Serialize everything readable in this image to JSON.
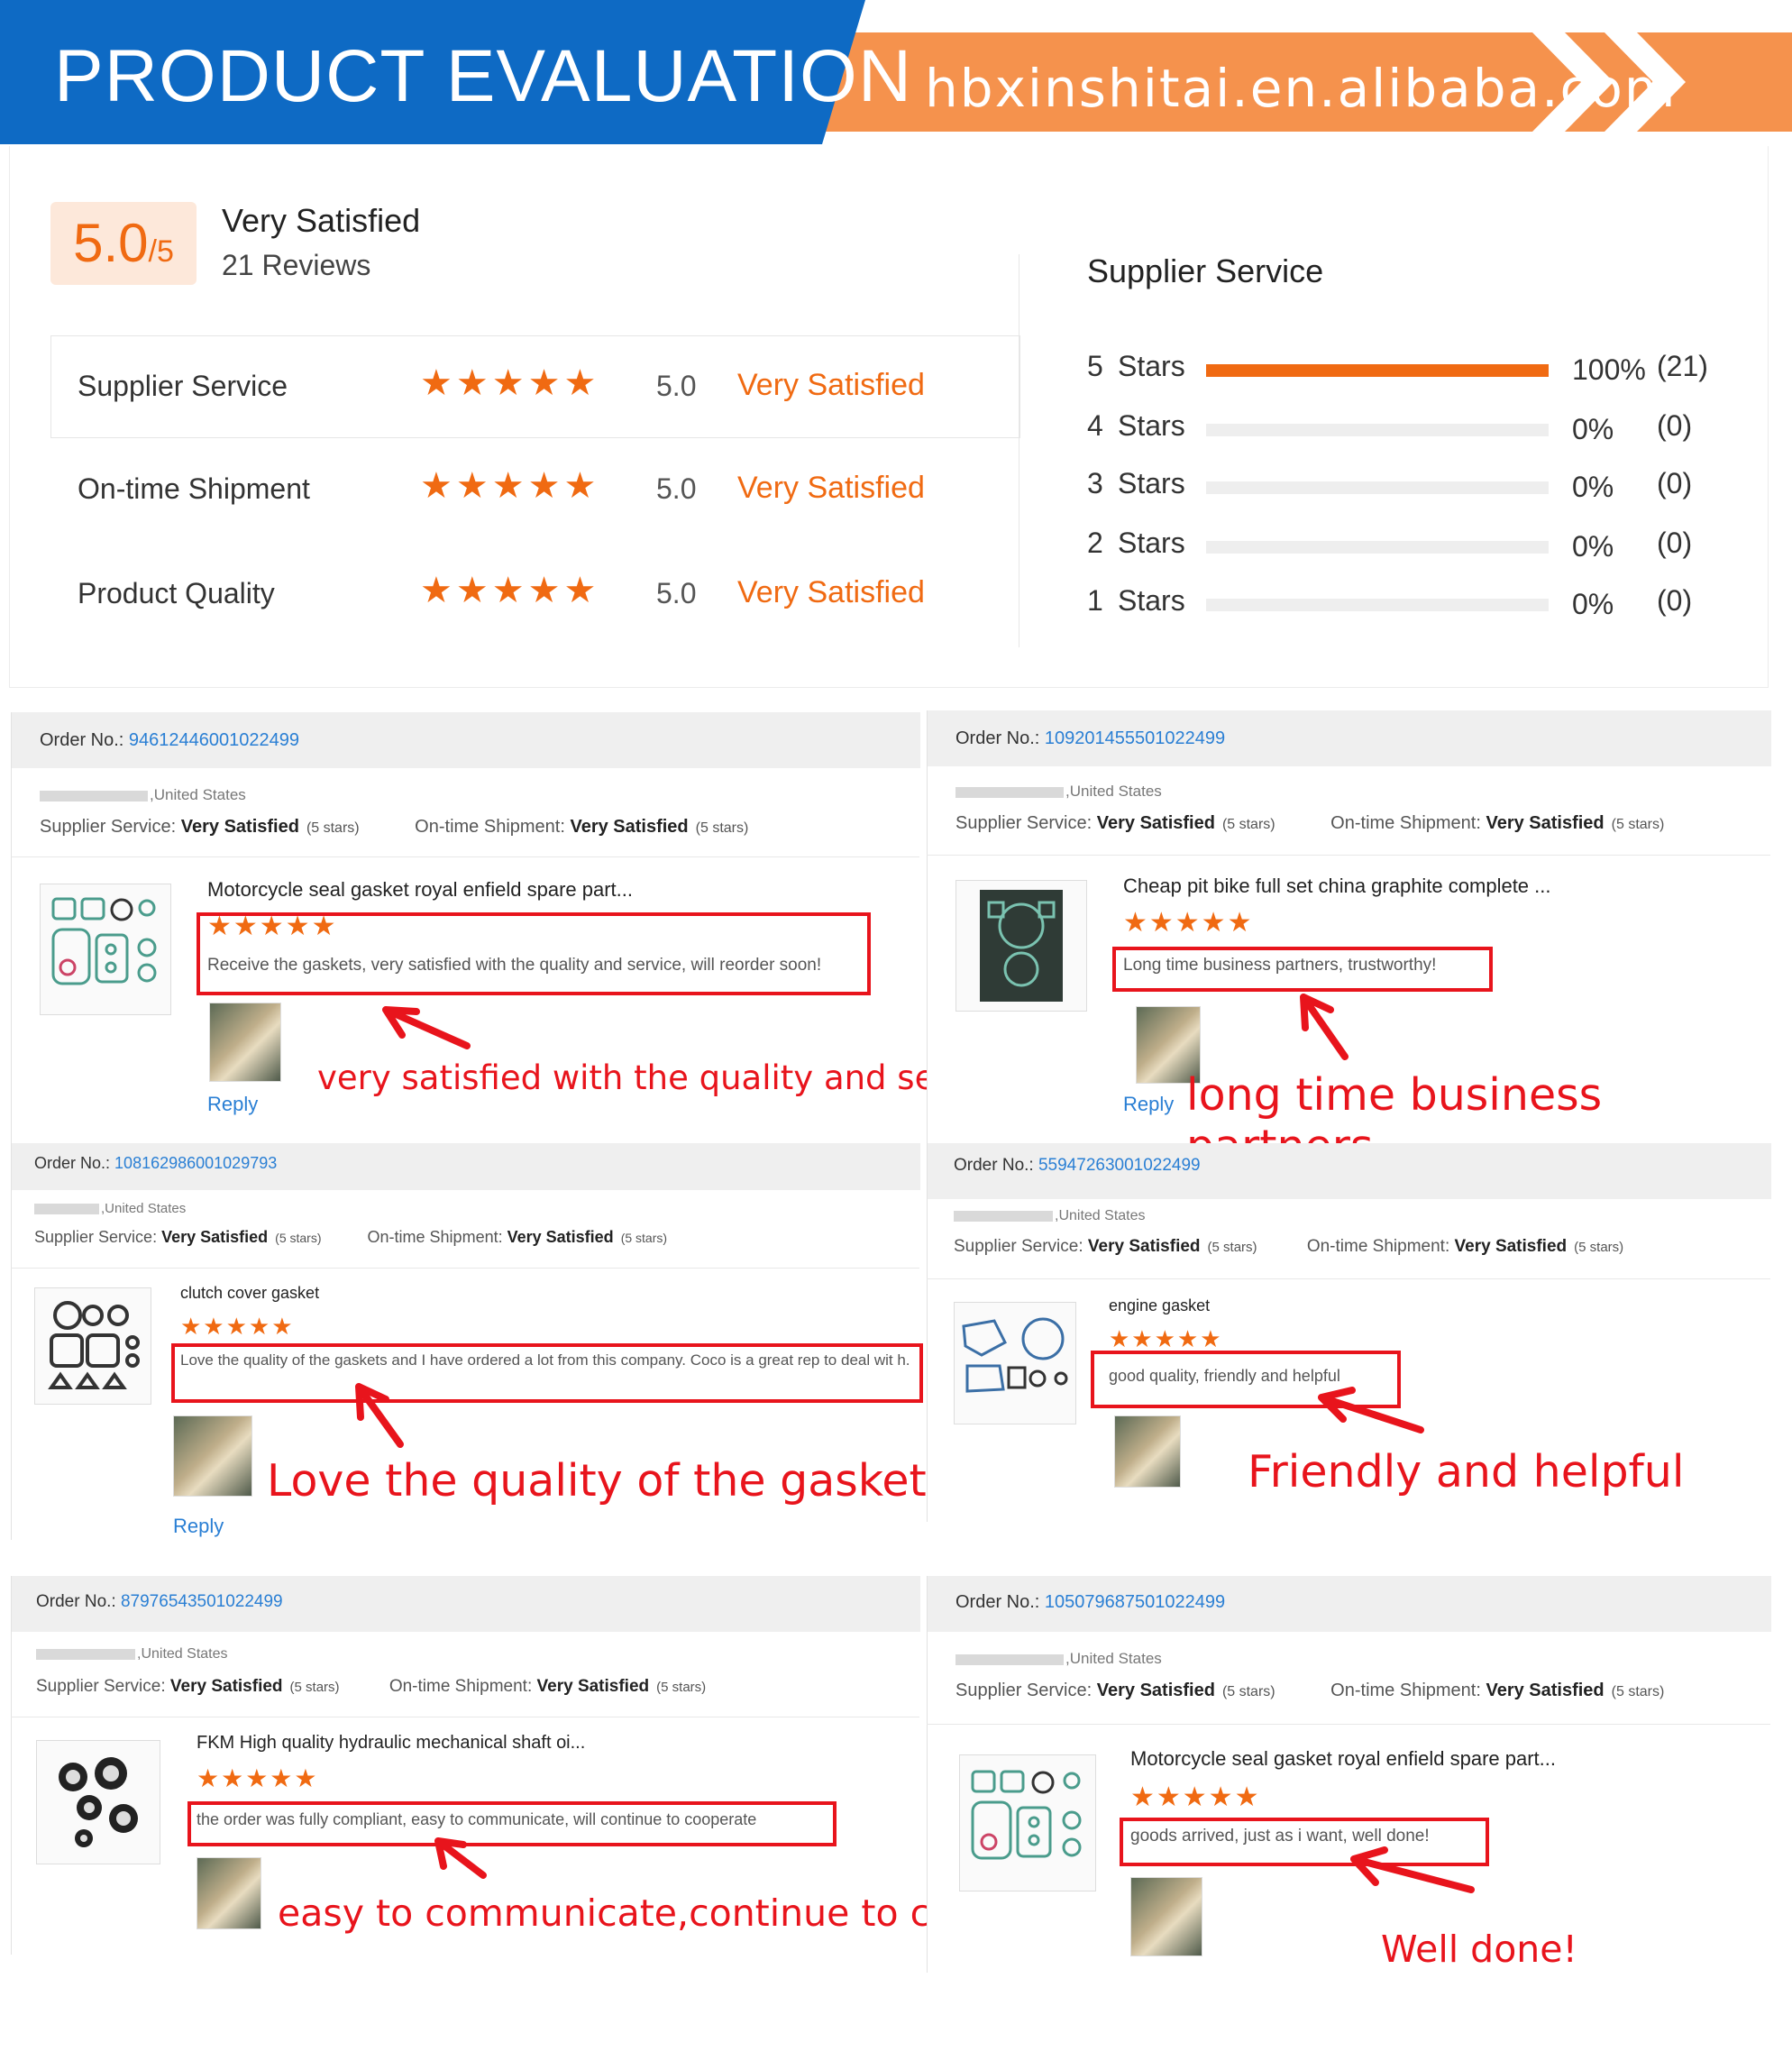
{
  "banner": {
    "title": "PRODUCT EVALUATION",
    "url": "hbxinshitai.en.alibaba.com"
  },
  "summary": {
    "score_big": "5.0",
    "score_small": "/5",
    "satisfaction": "Very Satisfied",
    "reviews": "21 Reviews",
    "categories": [
      {
        "label": "Supplier Service",
        "stars": "★★★★★",
        "score": "5.0",
        "status": "Very Satisfied"
      },
      {
        "label": "On-time Shipment",
        "stars": "★★★★★",
        "score": "5.0",
        "status": "Very Satisfied"
      },
      {
        "label": "Product Quality",
        "stars": "★★★★★",
        "score": "5.0",
        "status": "Very Satisfied"
      }
    ]
  },
  "distribution": {
    "title": "Supplier Service",
    "rows": [
      {
        "num": "5",
        "label": "Stars",
        "pct": "100%",
        "count": "(21)",
        "fraction": 1.0
      },
      {
        "num": "4",
        "label": "Stars",
        "pct": "0%",
        "count": "(0)",
        "fraction": 0
      },
      {
        "num": "3",
        "label": "Stars",
        "pct": "0%",
        "count": "(0)",
        "fraction": 0
      },
      {
        "num": "2",
        "label": "Stars",
        "pct": "0%",
        "count": "(0)",
        "fraction": 0
      },
      {
        "num": "1",
        "label": "Stars",
        "pct": "0%",
        "count": "(0)",
        "fraction": 0
      }
    ]
  },
  "common": {
    "order_label": "Order No.:",
    "country": ",United States",
    "supplier_service_label": "Supplier Service:",
    "shipment_label": "On-time Shipment:",
    "very_satisfied": "Very Satisfied",
    "five_stars": "(5 stars)",
    "review_stars": "★★★★★",
    "reply": "Reply"
  },
  "orders": [
    {
      "order_no": "94612446001022499",
      "product": "Motorcycle seal gasket royal enfield spare part...",
      "review": "Receive the gaskets, very satisfied with the quality and service, will reorder soon!",
      "annotation": "very satisfied with the quality and service"
    },
    {
      "order_no": "109201455501022499",
      "product": "Cheap pit bike full set china graphite complete ...",
      "review": "Long time business partners, trustworthy!",
      "annotation": "long time business partners"
    },
    {
      "order_no": "108162986001029793",
      "product": "clutch cover gasket",
      "review": "Love the quality of the gaskets and I have ordered a lot from this company. Coco is a great rep to deal wit h.",
      "annotation": "Love the quality of the gasket"
    },
    {
      "order_no": "55947263001022499",
      "product": "engine gasket",
      "review": "good quality, friendly and helpful",
      "annotation": "Friendly and helpful"
    },
    {
      "order_no": "87976543501022499",
      "product": "FKM High quality hydraulic mechanical shaft oi...",
      "review": "the order was fully compliant, easy to communicate, will continue to cooperate",
      "annotation": "easy to communicate,continue to cooperate"
    },
    {
      "order_no": "105079687501022499",
      "product": "Motorcycle seal gasket royal enfield spare part...",
      "review": "goods arrived, just as i want, well done!",
      "annotation": "Well done!"
    }
  ]
}
